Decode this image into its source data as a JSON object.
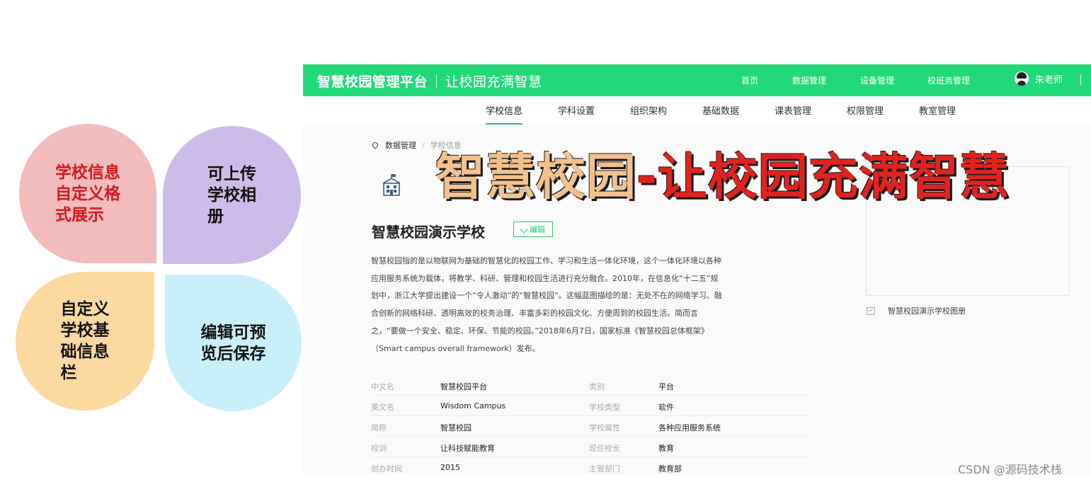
{
  "petals": [
    {
      "text": "学校信息\n自定义格\n式展示",
      "color": "#f2bbbc",
      "text_color": "#d8171d"
    },
    {
      "text": "可上传\n学校相\n册",
      "color": "#cdbce9",
      "text_color": "#111111"
    },
    {
      "text": "自定义\n学校基\n础信息\n栏",
      "color": "#fcd9a1",
      "text_color": "#111111"
    },
    {
      "text": "编辑可预\n览后保存",
      "color": "#c9effa",
      "text_color": "#111111"
    }
  ],
  "header": {
    "brand": "智慧校园管理平台",
    "slogan": "让校园充满智慧",
    "nav": [
      "首页",
      "数据管理",
      "设备管理",
      "校班务管理"
    ],
    "user_name": "朱老师",
    "color": "#22d97a"
  },
  "subnav": {
    "tabs": [
      "学校信息",
      "学科设置",
      "组织架构",
      "基础数据",
      "课表管理",
      "权限管理",
      "教室管理"
    ],
    "active": "学校信息",
    "accent": "#22c476"
  },
  "breadcrumb": [
    "数据管理",
    "学校信息"
  ],
  "school": {
    "name": "智慧校园演示学校",
    "edit_label": "编辑",
    "description": "智慧校园指的是以物联网为基础的智慧化的校园工作、学习和生活一体化环境，这个一体化环境以各种应用服务系统为载体，将教学、科研、管理和校园生活进行充分融合。2010年，在信息化“十二五”规划中，浙江大学提出建设一个“令人激动”的“智慧校园”。这幅蓝图描绘的是：无处不在的网络学习、融合创新的网络科研、透明高效的校务治理、丰富多彩的校园文化、方便周到的校园生活。简而言之，“要做一个安全、稳定、环保、节能的校园。”2018年6月7日，国家标准《智慧校园总体框架》（Smart campus overall framework）发布。",
    "album_caption": "智慧校园演示学校图册"
  },
  "info_rows": [
    {
      "k1": "中文名",
      "v1": "智慧校园平台",
      "k2": "类别",
      "v2": "平台"
    },
    {
      "k1": "英文名",
      "v1": "Wisdom Campus",
      "k2": "学校类型",
      "v2": "软件"
    },
    {
      "k1": "简称",
      "v1": "智慧校园",
      "k2": "学校属性",
      "v2": "各种应用服务系统"
    },
    {
      "k1": "校训",
      "v1": "让科技赋能教育",
      "k2": "现任校长",
      "v2": "教育"
    },
    {
      "k1": "创办时间",
      "v1": "2015",
      "k2": "主管部门",
      "v2": "教育部"
    }
  ],
  "overlay": {
    "part1": "智慧校园",
    "part2": "-让校园充满智慧"
  },
  "watermark": "CSDN @源码技术栈"
}
